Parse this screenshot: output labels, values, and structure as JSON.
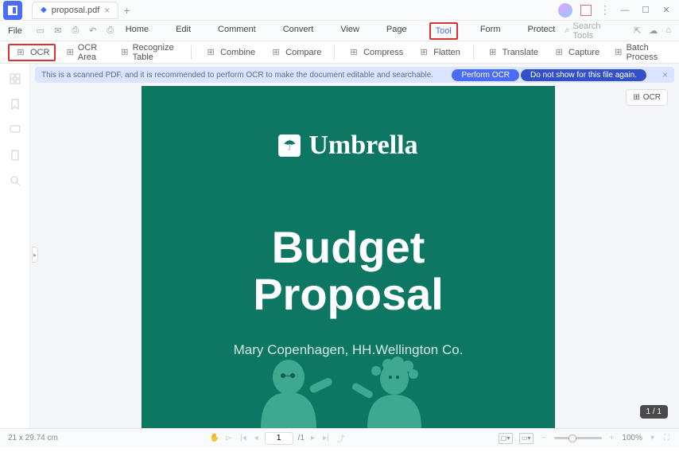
{
  "titlebar": {
    "tab_name": "proposal.pdf"
  },
  "menubar": {
    "file": "File",
    "items": [
      "Home",
      "Edit",
      "Comment",
      "Convert",
      "View",
      "Page",
      "Tool",
      "Form",
      "Protect"
    ],
    "highlighted_index": 6,
    "search_placeholder": "Search Tools"
  },
  "toolbar": {
    "items": [
      {
        "label": "OCR",
        "highlighted": true
      },
      {
        "label": "OCR Area",
        "highlighted": false
      },
      {
        "label": "Recognize Table",
        "highlighted": false
      },
      {
        "label": "Combine",
        "highlighted": false
      },
      {
        "label": "Compare",
        "highlighted": false
      },
      {
        "label": "Compress",
        "highlighted": false
      },
      {
        "label": "Flatten",
        "highlighted": false
      },
      {
        "label": "Translate",
        "highlighted": false
      },
      {
        "label": "Capture",
        "highlighted": false
      },
      {
        "label": "Batch Process",
        "highlighted": false
      }
    ]
  },
  "notif": {
    "text": "This is a scanned PDF, and it is recommended to perform OCR to make the document editable and searchable.",
    "btn1": "Perform OCR",
    "btn2": "Do not show for this file again."
  },
  "document": {
    "brand": "Umbrella",
    "title_l1": "Budget",
    "title_l2": "Proposal",
    "subtitle": "Mary Copenhagen, HH.Wellington Co."
  },
  "ocr_badge": "OCR",
  "page_indicator": "1 / 1",
  "status": {
    "dimensions": "21 x 29.74 cm",
    "page_current": "1",
    "page_total": "/1",
    "zoom": "100%"
  }
}
